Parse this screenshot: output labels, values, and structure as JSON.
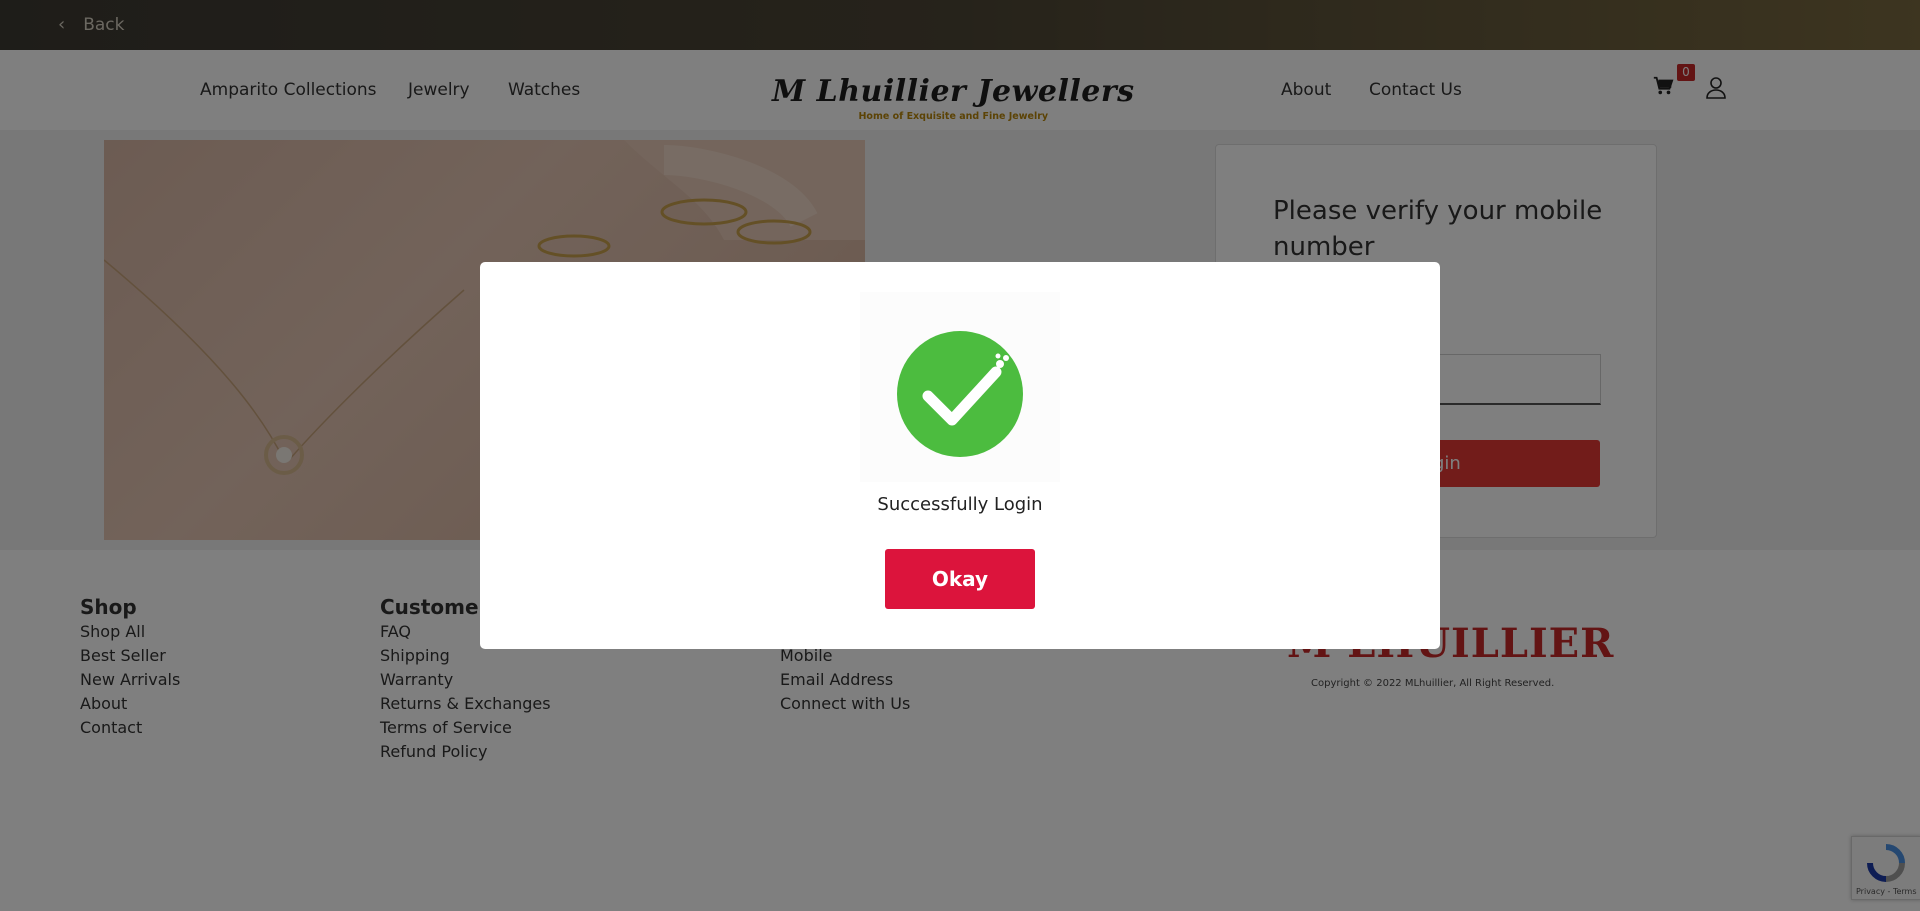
{
  "topbar": {
    "back_label": "Back"
  },
  "nav": {
    "left_links": [
      "Amparito Collections",
      "Jewelry",
      "Watches"
    ],
    "right_links": [
      "About",
      "Contact Us"
    ],
    "logo_title": "M Lhuillier Jewellers",
    "logo_subtitle": "Home of Exquisite and Fine Jewelry",
    "cart_count": "0"
  },
  "verify": {
    "title": "Please verify your mobile number",
    "button_label": "Login"
  },
  "footer": {
    "shop": {
      "heading": "Shop",
      "items": [
        "Shop All",
        "Best Seller",
        "New Arrivals",
        "About",
        "Contact"
      ]
    },
    "customer": {
      "heading": "Customer",
      "items": [
        "FAQ",
        "Shipping",
        "Warranty",
        "Returns & Exchanges",
        "Terms of Service",
        "Refund Policy"
      ]
    },
    "contact": {
      "items": [
        "Mobile",
        "Email Address",
        "Connect with Us"
      ]
    },
    "brand": "M LHUILLIER",
    "copyright": "Copyright © 2022 MLhuillier, All Right Reserved."
  },
  "recaptcha": {
    "text": "Privacy - Terms"
  },
  "modal": {
    "message": "Successfully Login",
    "ok_label": "Okay",
    "icon": "success-check-icon",
    "icon_color": "#4cbc3f",
    "button_color": "#dc143c"
  }
}
